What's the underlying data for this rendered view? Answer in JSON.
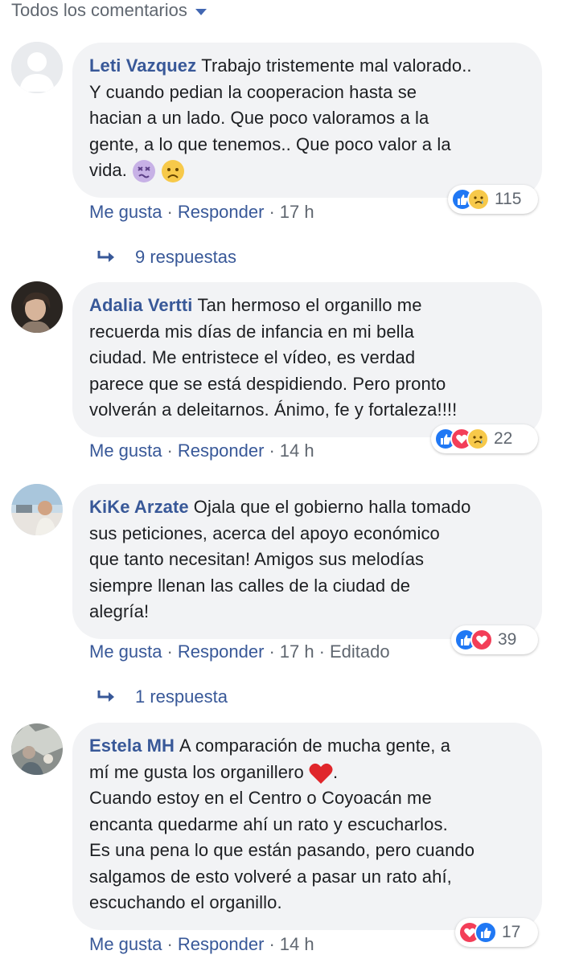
{
  "filter": {
    "label": "Todos los comentarios"
  },
  "comments": [
    {
      "author": "Leti Vazquez",
      "lines": [
        "Trabajo tristemente mal valorado..",
        "Y cuando pedian la cooperacion hasta se",
        "hacian a un lado. Que poco valoramos a la",
        "gente, a lo que tenemos.. Que poco valor a la",
        "vida."
      ],
      "emojis": [
        "dizzy-face",
        "frowning-face"
      ],
      "like": "Me gusta",
      "reply": "Responder",
      "time": "17 h",
      "reactions": [
        "like",
        "sad"
      ],
      "reaction_count": "115",
      "replies": "9 respuestas"
    },
    {
      "author": "Adalia Vertti",
      "lines": [
        "Tan hermoso el organillo me",
        "recuerda mis días de infancia en mi bella",
        "ciudad. Me entristece el vídeo, es verdad",
        "parece que se está despidiendo. Pero pronto",
        "volverán a deleitarnos. Ánimo, fe y fortaleza!!!!"
      ],
      "like": "Me gusta",
      "reply": "Responder",
      "time": "14 h",
      "reactions": [
        "like",
        "love",
        "sad"
      ],
      "reaction_count": "22"
    },
    {
      "author": "KiKe Arzate",
      "lines": [
        "Ojala que el gobierno halla tomado",
        "sus peticiones, acerca del apoyo económico",
        "que tanto necesitan! Amigos sus melodías",
        "siempre llenan las calles de la ciudad de",
        "alegría!"
      ],
      "like": "Me gusta",
      "reply": "Responder",
      "time": "17 h",
      "edited": "Editado",
      "reactions": [
        "like",
        "love"
      ],
      "reaction_count": "39",
      "replies": "1 respuesta"
    },
    {
      "author": "Estela MH",
      "lines": [
        "A comparación de mucha gente, a",
        "mí me gusta los organillero",
        "Cuando estoy en el Centro o Coyoacán me",
        "encanta quedarme ahí un rato y escucharlos.",
        "Es una pena lo que están pasando, pero cuando",
        "salgamos de esto volveré a pasar un rato ahí,",
        "escuchando el organillo."
      ],
      "line2_suffix": ".",
      "like": "Me gusta",
      "reply": "Responder",
      "time": "14 h",
      "reactions": [
        "love",
        "like"
      ],
      "reaction_count": "17"
    }
  ],
  "colors": {
    "link": "#385898",
    "bubble": "#f2f3f5",
    "meta": "#606770"
  }
}
